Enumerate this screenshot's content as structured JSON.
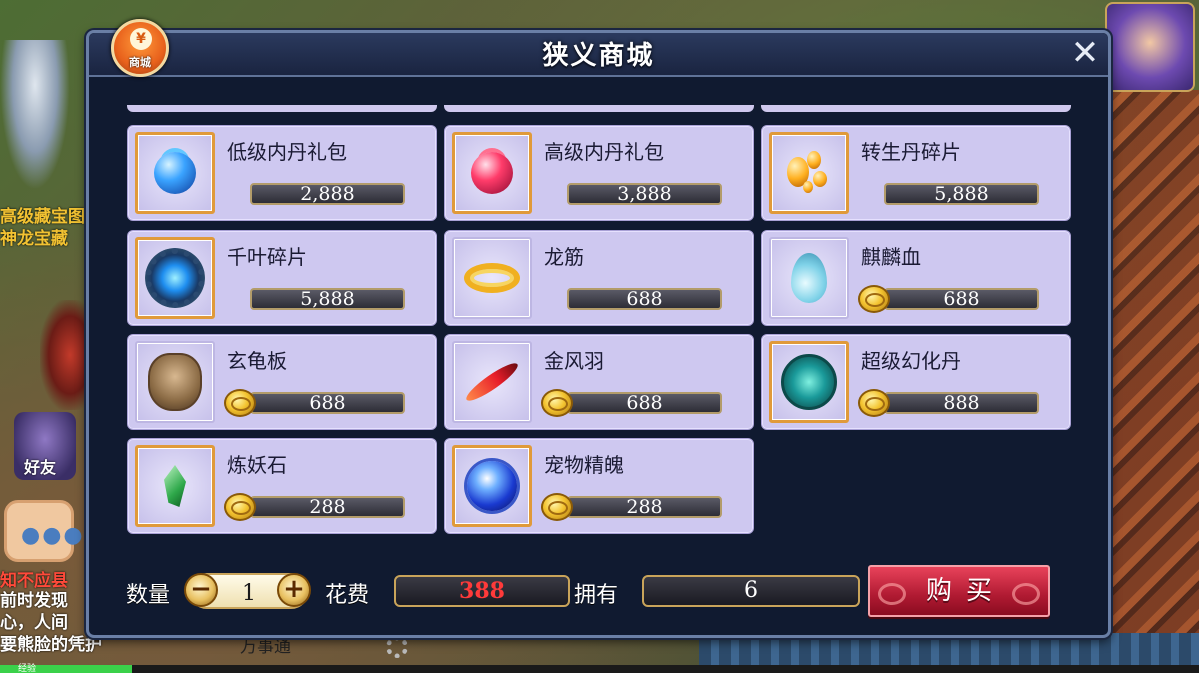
{
  "game": {
    "background_text": {
      "line1": "高级藏宝图",
      "line2": "神龙宝藏",
      "line3": "知不应县",
      "line4": "前时发现",
      "line5": "心，人间",
      "line6": "要熊脸的凭护",
      "bottom": "万事通",
      "exp_label": "经验"
    },
    "friend_button_label": "好友",
    "exp_progress": 0.11
  },
  "shop": {
    "title": "狭义商城",
    "badge_label": "商城",
    "badge_symbol": "¥",
    "close_symbol": "✕",
    "items": [
      {
        "name": "低级内丹礼包",
        "price": "2,888",
        "icon": "inner-core-blue-icon",
        "coin": false,
        "framed": true
      },
      {
        "name": "高级内丹礼包",
        "price": "3,888",
        "icon": "inner-core-red-icon",
        "coin": false,
        "framed": true
      },
      {
        "name": "转生丹碎片",
        "price": "5,888",
        "icon": "rebirth-pill-icon",
        "coin": false,
        "framed": true
      },
      {
        "name": "千叶碎片",
        "price": "5,888",
        "icon": "thousand-leaf-icon",
        "coin": false,
        "framed": true
      },
      {
        "name": "龙筋",
        "price": "688",
        "icon": "dragon-tendon-icon",
        "coin": false,
        "framed": false
      },
      {
        "name": "麒麟血",
        "price": "688",
        "icon": "qilin-blood-icon",
        "coin": true,
        "framed": false
      },
      {
        "name": "玄龟板",
        "price": "688",
        "icon": "turtle-shell-icon",
        "coin": true,
        "framed": false
      },
      {
        "name": "金风羽",
        "price": "688",
        "icon": "golden-feather-icon",
        "coin": true,
        "framed": false
      },
      {
        "name": "超级幻化丹",
        "price": "888",
        "icon": "transform-pill-icon",
        "coin": true,
        "framed": true
      },
      {
        "name": "炼妖石",
        "price": "288",
        "icon": "refine-stone-icon",
        "coin": true,
        "framed": true
      },
      {
        "name": "宠物精魄",
        "price": "288",
        "icon": "pet-soul-icon",
        "coin": true,
        "framed": true
      }
    ],
    "footer": {
      "quantity_label": "数量",
      "quantity_value": "1",
      "minus_symbol": "−",
      "plus_symbol": "+",
      "cost_label": "花费",
      "cost_value": "388",
      "own_label": "拥有",
      "own_value": "6",
      "buy_label": "购买"
    }
  }
}
